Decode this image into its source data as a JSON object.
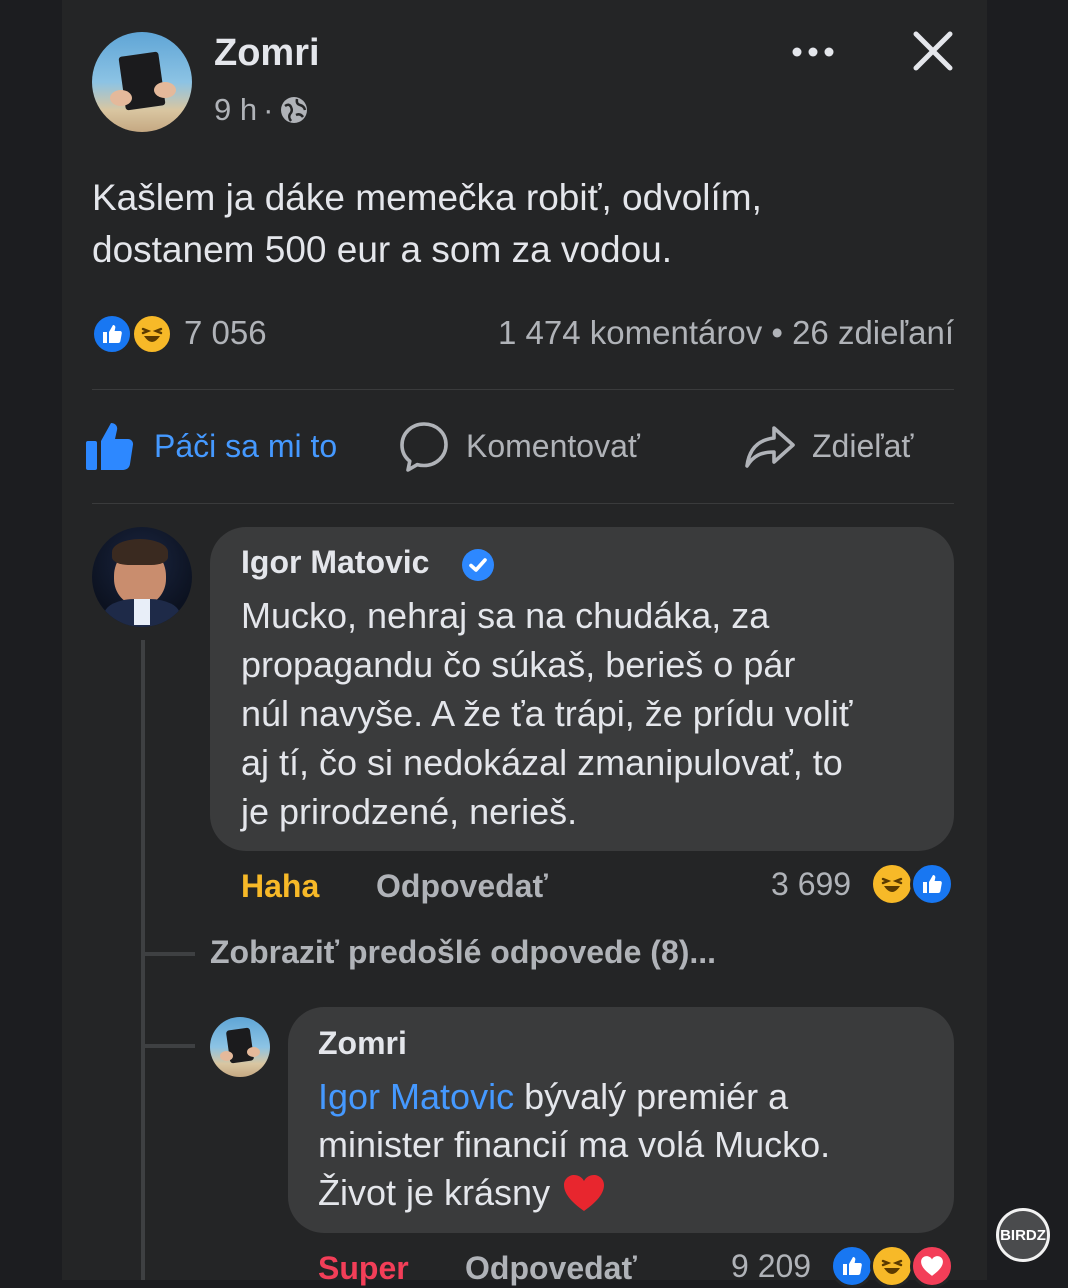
{
  "post": {
    "author": "Zomri",
    "time": "9 h",
    "separator": "·",
    "text_line1": "Kašlem ja dáke memečka robiť, odvolím,",
    "text_line2": "dostanem 500 eur a som za vodou.",
    "reaction_count": "7 056",
    "comments_shares": "1 474 komentárov • 26 zdieľaní"
  },
  "actions": {
    "like": "Páči sa mi to",
    "comment": "Komentovať",
    "share": "Zdieľať"
  },
  "comment1": {
    "author": "Igor Matovic",
    "lines": [
      "Mucko, nehraj sa na chudáka, za",
      "propagandu čo súkaš, berieš o pár",
      "núl navyše. A že ťa trápi, že prídu voliť",
      "aj tí, čo si nedokázal zmanipulovať, to",
      "je prirodzené, nerieš."
    ],
    "reaction_label": "Haha",
    "reply": "Odpovedať",
    "count": "3 699"
  },
  "show_previous": "Zobraziť predošlé odpovede (8)...",
  "reply1": {
    "author": "Zomri",
    "mention": "Igor Matovic",
    "line1_rest": " bývalý premiér a",
    "line2": "minister financií ma volá Mucko.",
    "line3": "Život je krásny",
    "reaction_label": "Super",
    "reply": "Odpovedať",
    "count": "9 209"
  },
  "watermark": "BIRDZ",
  "colors": {
    "like_blue": "#1877f2",
    "haha_yellow": "#f7b928",
    "love_red": "#f33e58",
    "mention_blue": "#4599ff",
    "verified_blue": "#2d88ff"
  },
  "icons": [
    "more-icon",
    "close-icon",
    "globe-icon",
    "like-icon",
    "comment-icon",
    "share-icon",
    "heart-emoji"
  ]
}
